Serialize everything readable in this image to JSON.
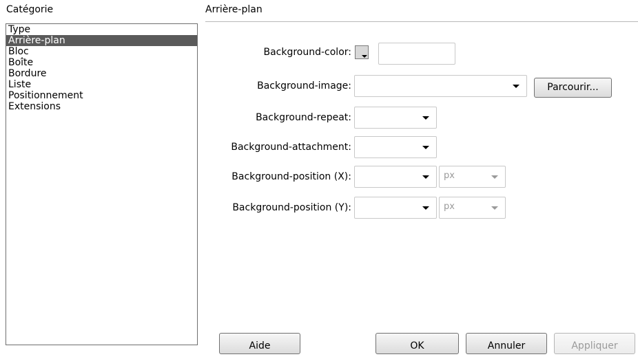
{
  "category_header": "Catégorie",
  "panel_title": "Arrière-plan",
  "categories": [
    "Type",
    "Arrière-plan",
    "Bloc",
    "Boîte",
    "Bordure",
    "Liste",
    "Positionnement",
    "Extensions"
  ],
  "selected_category": "Arrière-plan",
  "fields": {
    "bg_color_label": "Background-color:",
    "bg_image_label": "Background-image:",
    "bg_repeat_label": "Background-repeat:",
    "bg_attachment_label": "Background-attachment:",
    "bg_pos_x_label": "Background-position (X):",
    "bg_pos_y_label": "Background-position (Y):",
    "bg_color_value": "",
    "bg_image_value": "",
    "bg_repeat_value": "",
    "bg_attachment_value": "",
    "bg_pos_x_value": "",
    "bg_pos_y_value": "",
    "unit_x": "px",
    "unit_y": "px"
  },
  "buttons": {
    "browse": "Parcourir...",
    "help": "Aide",
    "ok": "OK",
    "cancel": "Annuler",
    "apply": "Appliquer"
  },
  "colors": {
    "selection": "#5a5a5a",
    "swatch": "#d8d8d8"
  }
}
